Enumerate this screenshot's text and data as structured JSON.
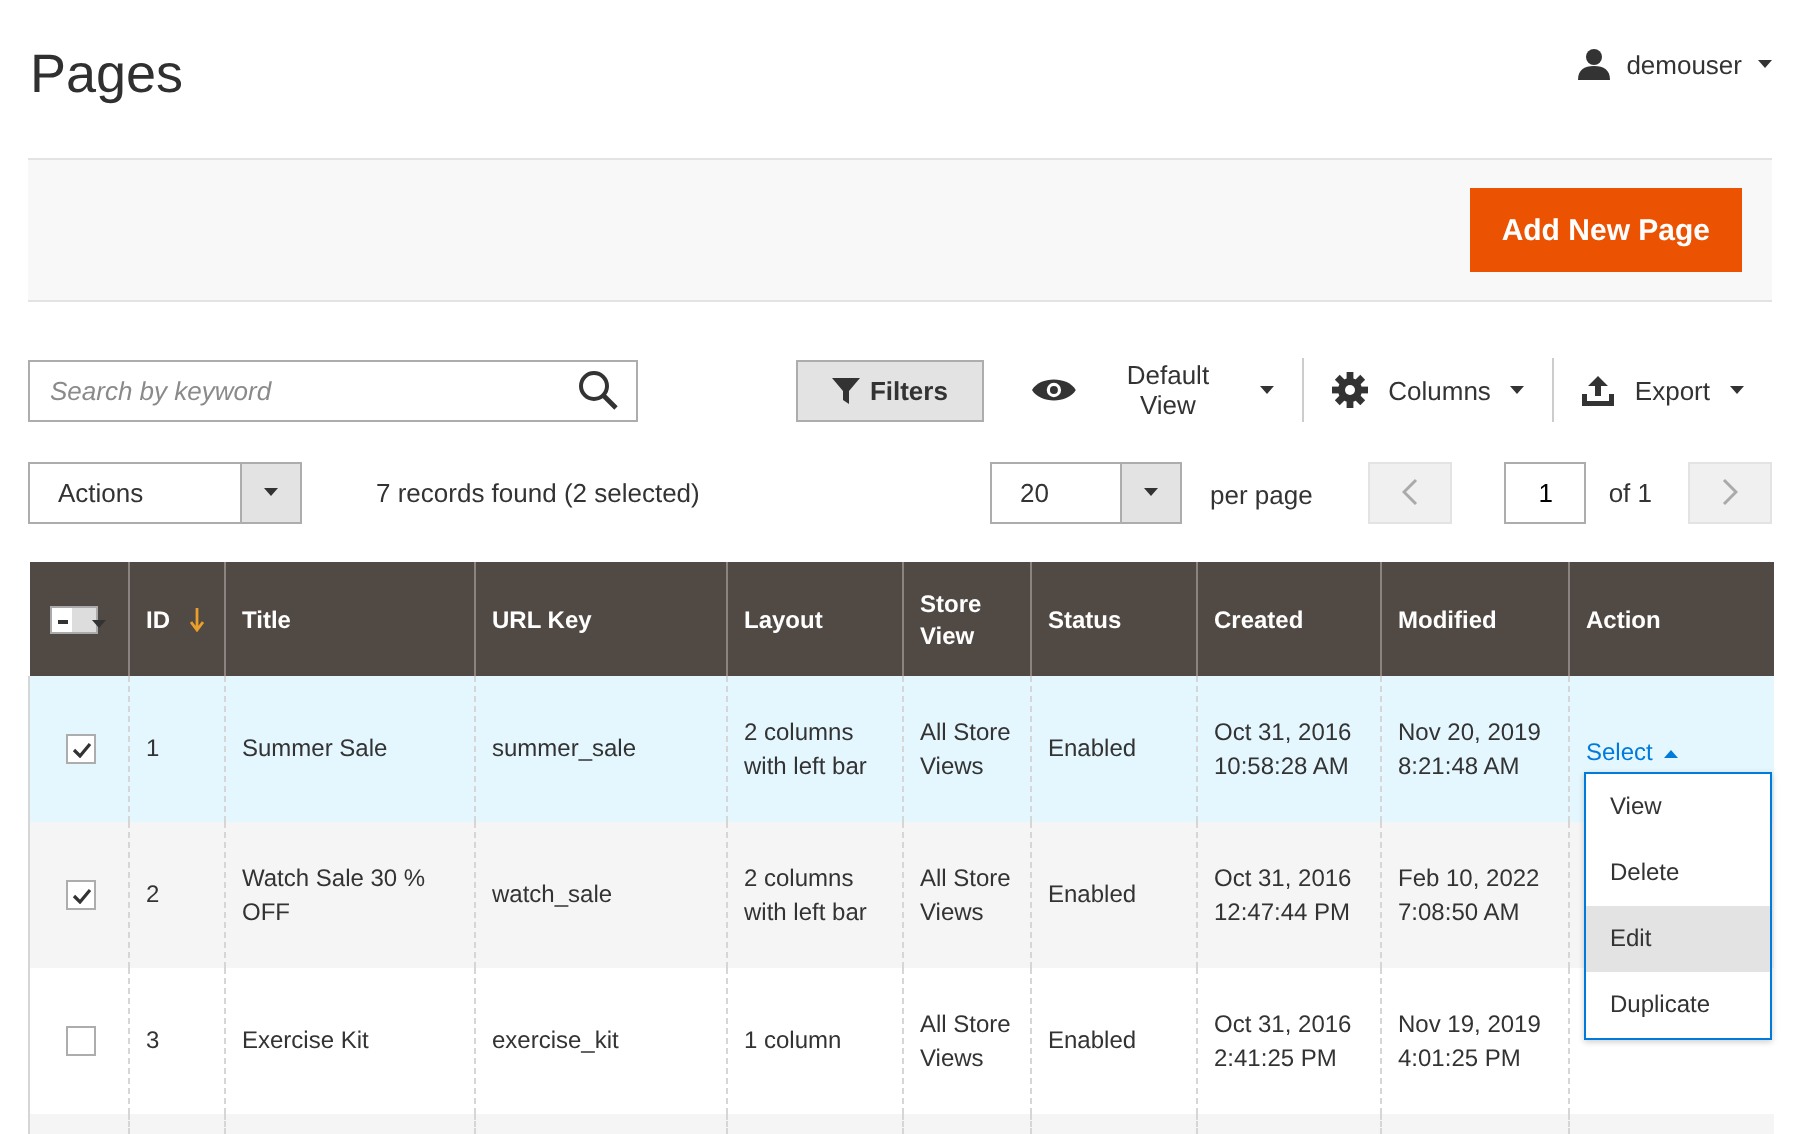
{
  "page_title": "Pages",
  "user": {
    "name": "demouser"
  },
  "primary_button": "Add New Page",
  "search": {
    "placeholder": "Search by keyword"
  },
  "toolbar": {
    "filters": "Filters",
    "view": "Default View",
    "columns": "Columns",
    "export": "Export"
  },
  "actions_select": "Actions",
  "records": "7 records found (2 selected)",
  "pager": {
    "per_page_value": "20",
    "per_page_label": "per page",
    "page": "1",
    "of": "of 1"
  },
  "table": {
    "columns": [
      {
        "label": "ID",
        "sorted": true
      },
      {
        "label": "Title",
        "sorted": false
      },
      {
        "label": "URL Key",
        "sorted": false
      },
      {
        "label": "Layout",
        "sorted": false
      },
      {
        "label": "Store View",
        "sorted": false
      },
      {
        "label": "Status",
        "sorted": false
      },
      {
        "label": "Created",
        "sorted": false
      },
      {
        "label": "Modified",
        "sorted": false
      },
      {
        "label": "Action",
        "sorted": false
      }
    ],
    "rows": [
      {
        "checked": true,
        "active": true,
        "cells": [
          "1",
          "Summer Sale",
          "summer_sale",
          "2 columns with left bar",
          "All Store Views",
          "Enabled",
          "Oct 31, 2016 10:58:28 AM",
          "Nov 20, 2019 8:21:48 AM"
        ],
        "action": "Select",
        "menu": [
          {
            "label": "View",
            "selected": false
          },
          {
            "label": "Delete",
            "selected": false
          },
          {
            "label": "Edit",
            "selected": true
          },
          {
            "label": "Duplicate",
            "selected": false
          }
        ]
      },
      {
        "checked": true,
        "active": false,
        "cells": [
          "2",
          "Watch Sale 30 % OFF",
          "watch_sale",
          "2 columns with left bar",
          "All Store Views",
          "Enabled",
          "Oct 31, 2016 12:47:44 PM",
          "Feb 10, 2022 7:08:50 AM"
        ]
      },
      {
        "checked": false,
        "active": false,
        "cells": [
          "3",
          "Exercise Kit",
          "exercise_kit",
          "1 column",
          "All Store Views",
          "Enabled",
          "Oct 31, 2016 2:41:25 PM",
          "Nov 19, 2019 4:01:25 PM"
        ]
      }
    ]
  }
}
